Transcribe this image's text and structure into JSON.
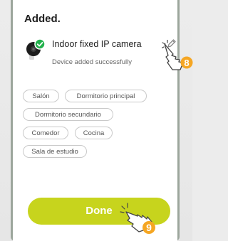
{
  "dialog": {
    "title": "Added.",
    "device": {
      "name": "Indoor fixed IP camera",
      "status": "Device added successfully"
    },
    "rooms": [
      "Salón",
      "Dormitorio principal",
      "Dormitorio secundario",
      "Comedor",
      "Cocina",
      "Sala de estudio"
    ],
    "done_label": "Done"
  },
  "callouts": {
    "edit_step": "8",
    "done_step": "9"
  },
  "colors": {
    "accent": "#c7d41d",
    "check_green": "#22b14c",
    "callout_orange": "#f5a623"
  }
}
